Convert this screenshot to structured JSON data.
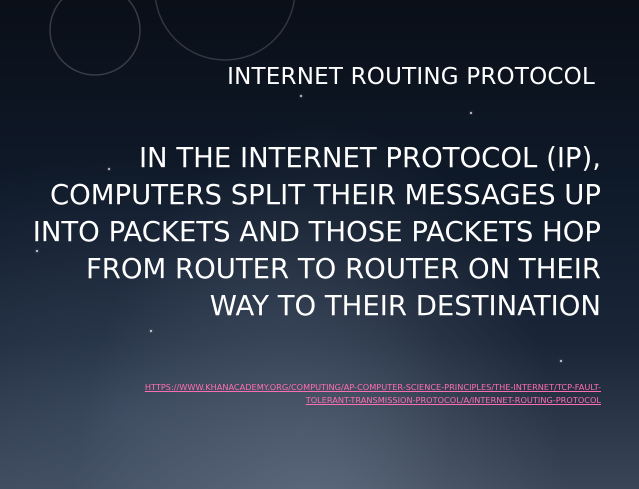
{
  "slide": {
    "title": "INTERNET ROUTING PROTOCOL",
    "body_lines": [
      "IN THE INTERNET PROTOCOL (IP),",
      "COMPUTERS SPLIT THEIR MESSAGES UP",
      "INTO PACKETS AND THOSE PACKETS HOP",
      "FROM ROUTER TO ROUTER ON THEIR",
      "WAY TO THEIR DESTINATION"
    ],
    "link_lines": [
      "HTTPS://WWW.KHANACADEMY.ORG/COMPUTING/AP-COMPUTER-SCIENCE-PRINCIPLES/THE-INTERNET/TCP-FAULT-",
      "TOLERANT-TRANSMISSION-PROTOCOL/A/INTERNET-ROUTING-PROTOCOL"
    ],
    "colors": {
      "text": "#ffffff",
      "link": "#ff6fb0",
      "background_top": "#0a0f18",
      "background_bottom": "#3a4658"
    }
  }
}
